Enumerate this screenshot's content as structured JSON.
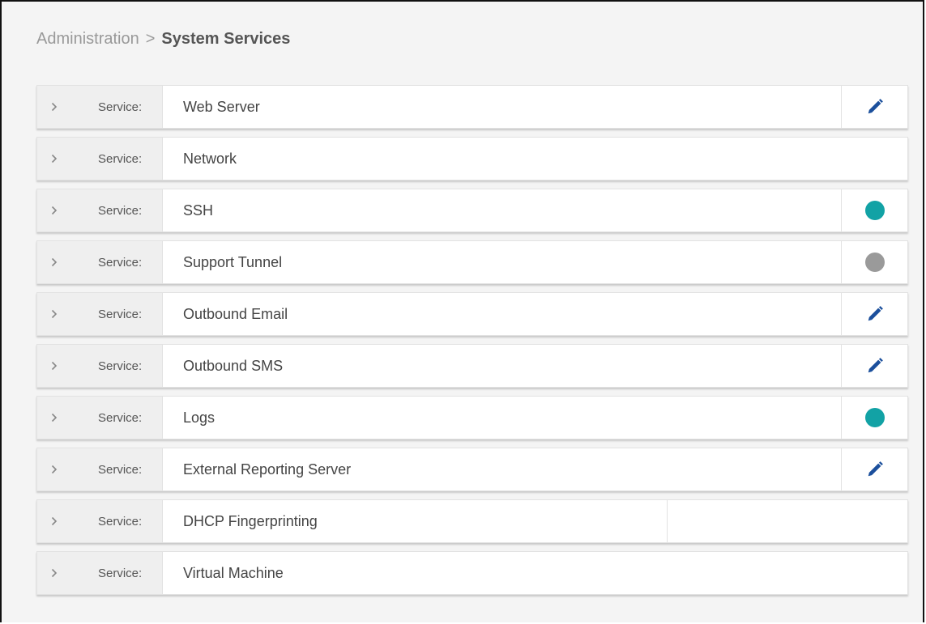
{
  "breadcrumb": {
    "parent": "Administration",
    "separator": ">",
    "current": "System Services"
  },
  "colors": {
    "status_active": "#12a2a5",
    "status_inactive": "#9a9a9a",
    "edit_icon": "#1b4f9c"
  },
  "services": [
    {
      "label": "Service:",
      "name": "Web Server",
      "action": "edit-icon"
    },
    {
      "label": "Service:",
      "name": "Network",
      "action": "none"
    },
    {
      "label": "Service:",
      "name": "SSH",
      "action": "status-active"
    },
    {
      "label": "Service:",
      "name": "Support Tunnel",
      "action": "status-inactive"
    },
    {
      "label": "Service:",
      "name": "Outbound Email",
      "action": "edit-icon"
    },
    {
      "label": "Service:",
      "name": "Outbound SMS",
      "action": "edit-icon"
    },
    {
      "label": "Service:",
      "name": "Logs",
      "action": "status-active"
    },
    {
      "label": "Service:",
      "name": "External Reporting Server",
      "action": "edit-icon"
    },
    {
      "label": "Service:",
      "name": "DHCP Fingerprinting",
      "action": "empty-panel"
    },
    {
      "label": "Service:",
      "name": "Virtual Machine",
      "action": "none"
    }
  ]
}
